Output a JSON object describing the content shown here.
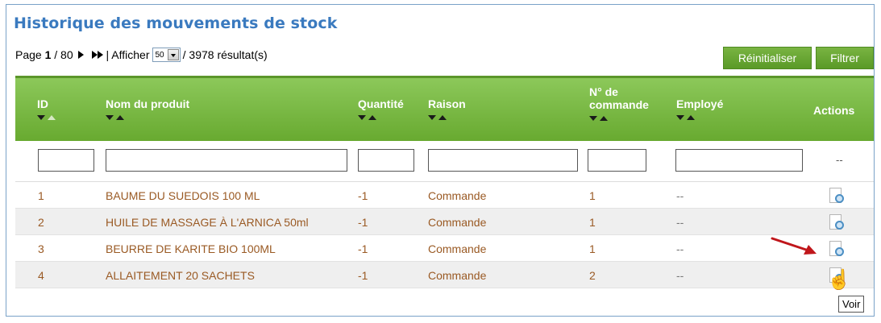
{
  "title": "Historique des mouvements de stock",
  "pager": {
    "prefix": "Page",
    "current": "1",
    "total": "/ 80",
    "separator": "| Afficher",
    "per_page": "50",
    "results": "/ 3978 résultat(s)"
  },
  "buttons": {
    "reset": "Réinitialiser",
    "filter": "Filtrer"
  },
  "columns": {
    "id": "ID",
    "product": "Nom du produit",
    "quantity": "Quantité",
    "reason": "Raison",
    "order_line1": "N° de",
    "order_line2": "commande",
    "employee": "Employé",
    "actions": "Actions"
  },
  "filter_actions_placeholder": "--",
  "rows": [
    {
      "id": "1",
      "product": "BAUME DU SUEDOIS 100 ML",
      "quantity": "-1",
      "reason": "Commande",
      "order": "1",
      "employee": "--"
    },
    {
      "id": "2",
      "product": "HUILE DE MASSAGE À L'ARNICA 50ml",
      "quantity": "-1",
      "reason": "Commande",
      "order": "1",
      "employee": "--"
    },
    {
      "id": "3",
      "product": "BEURRE DE KARITE BIO 100ML",
      "quantity": "-1",
      "reason": "Commande",
      "order": "1",
      "employee": "--"
    },
    {
      "id": "4",
      "product": "ALLAITEMENT 20 SACHETS",
      "quantity": "-1",
      "reason": "Commande",
      "order": "2",
      "employee": "--"
    }
  ],
  "tooltip": "Voir",
  "colors": {
    "accent_green": "#6aac34",
    "title_blue": "#3a7abf",
    "row_text": "#9a5a24",
    "arrow_red": "#c0161b"
  }
}
